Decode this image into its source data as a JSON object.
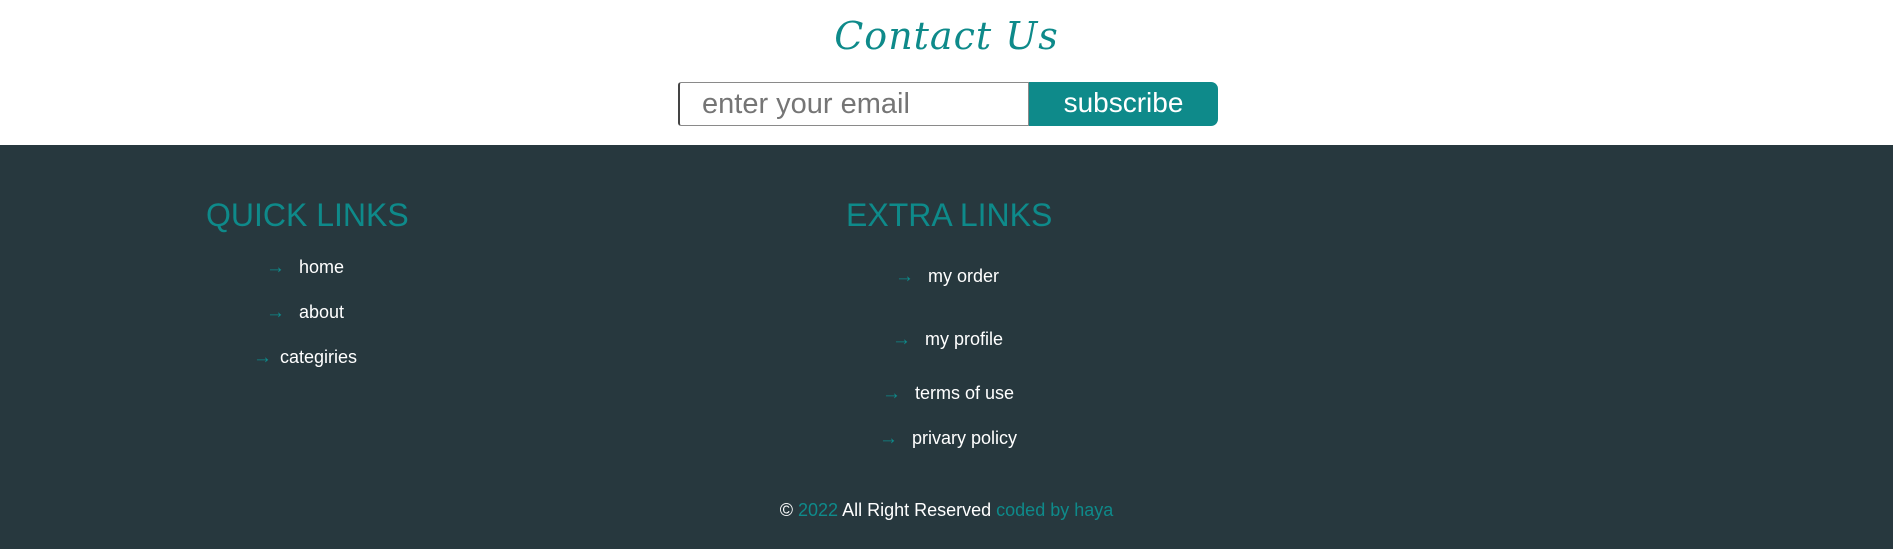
{
  "contact": {
    "title": "Contact Us",
    "email_placeholder": "enter your email",
    "subscribe_label": "subscribe"
  },
  "footer": {
    "quick_links": {
      "heading": "QUICK LINKS",
      "items": [
        {
          "label": "home",
          "icon": "arrow-right-icon"
        },
        {
          "label": "about",
          "icon": "arrow-right-icon"
        },
        {
          "label": "categiries",
          "icon": "arrow-right-icon"
        }
      ]
    },
    "extra_links": {
      "heading": "EXTRA LINKS",
      "items": [
        {
          "label": "my order",
          "icon": "arrow-right-icon"
        },
        {
          "label": "my profile",
          "icon": "arrow-right-icon"
        },
        {
          "label": "terms of use",
          "icon": "arrow-right-icon"
        },
        {
          "label": "privary policy",
          "icon": "arrow-right-icon"
        }
      ]
    },
    "copyright": {
      "symbol": "©",
      "year": "2022",
      "text": "All Right Reserved",
      "credit": "coded by haya"
    }
  },
  "colors": {
    "accent": "#0e8a8a",
    "footer_bg": "#27383e",
    "text_light": "#ffffff"
  }
}
